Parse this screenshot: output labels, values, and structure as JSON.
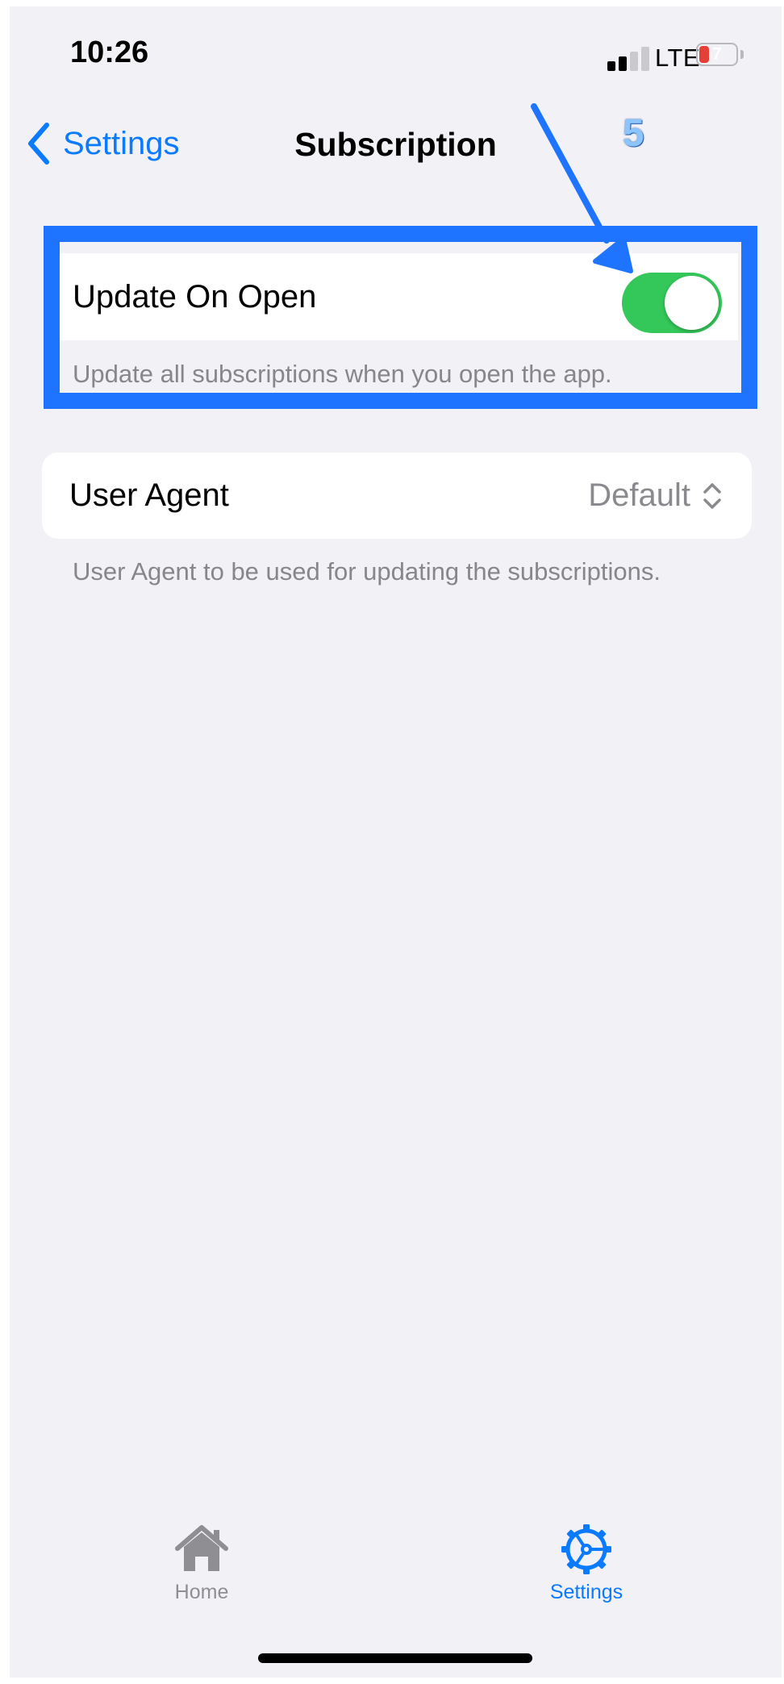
{
  "status_bar": {
    "time": "10:26",
    "network": "LTE",
    "battery": "7"
  },
  "nav": {
    "back_label": "Settings",
    "title": "Subscription"
  },
  "annotation": {
    "step": "5",
    "color": "#1f74ff"
  },
  "settings": {
    "update_on_open": {
      "label": "Update On Open",
      "enabled": true,
      "footer": "Update all subscriptions when you open the app."
    },
    "user_agent": {
      "label": "User Agent",
      "value": "Default",
      "footer": "User Agent to be used for updating the subscriptions."
    }
  },
  "tab_bar": {
    "tabs": [
      {
        "label": "Home",
        "icon": "house-icon",
        "selected": false
      },
      {
        "label": "Settings",
        "icon": "gear-icon",
        "selected": true
      }
    ]
  },
  "colors": {
    "accent": "#0a7aff",
    "toggle_on": "#34c759",
    "background": "#f1f1f6"
  }
}
